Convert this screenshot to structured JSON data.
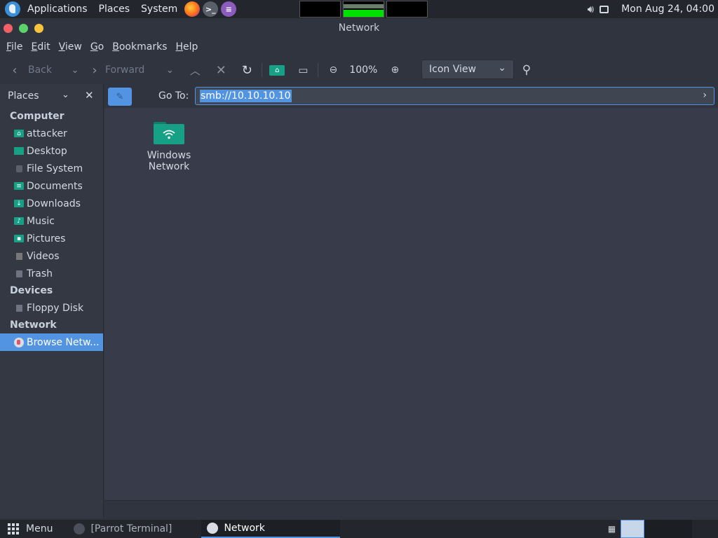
{
  "top_panel": {
    "menus": [
      "Applications",
      "Places",
      "System"
    ],
    "clock": "Mon Aug 24, 04:00"
  },
  "window": {
    "title": "Network",
    "menubar": [
      "File",
      "Edit",
      "View",
      "Go",
      "Bookmarks",
      "Help"
    ],
    "menubar_mnemonics": [
      "F",
      "E",
      "V",
      "G",
      "B",
      "H"
    ],
    "menubar_rest": [
      "ile",
      "dit",
      "iew",
      "o",
      "ookmarks",
      "elp"
    ],
    "toolbar": {
      "back_label": "Back",
      "forward_label": "Forward",
      "zoom_level": "100%",
      "view_mode": "Icon View"
    },
    "sidebar": {
      "title": "Places",
      "sections": [
        {
          "header": "Computer",
          "items": [
            "attacker",
            "Desktop",
            "File System",
            "Documents",
            "Downloads",
            "Music",
            "Pictures",
            "Videos",
            "Trash"
          ]
        },
        {
          "header": "Devices",
          "items": [
            "Floppy Disk"
          ]
        },
        {
          "header": "Network",
          "items": [
            "Browse Netw..."
          ]
        }
      ]
    },
    "location": {
      "label": "Go To:",
      "value": "smb://10.10.10.10"
    },
    "content": {
      "items": [
        {
          "label": "Windows Network",
          "icon": "network-folder-icon"
        }
      ]
    }
  },
  "bottom_panel": {
    "menu_label": "Menu",
    "tasks": [
      "[Parrot Terminal]",
      "Network"
    ]
  },
  "colors": {
    "accent": "#5294e2",
    "folder": "#16a085",
    "content_bg": "#383c4a",
    "sidebar_bg": "#333843"
  }
}
